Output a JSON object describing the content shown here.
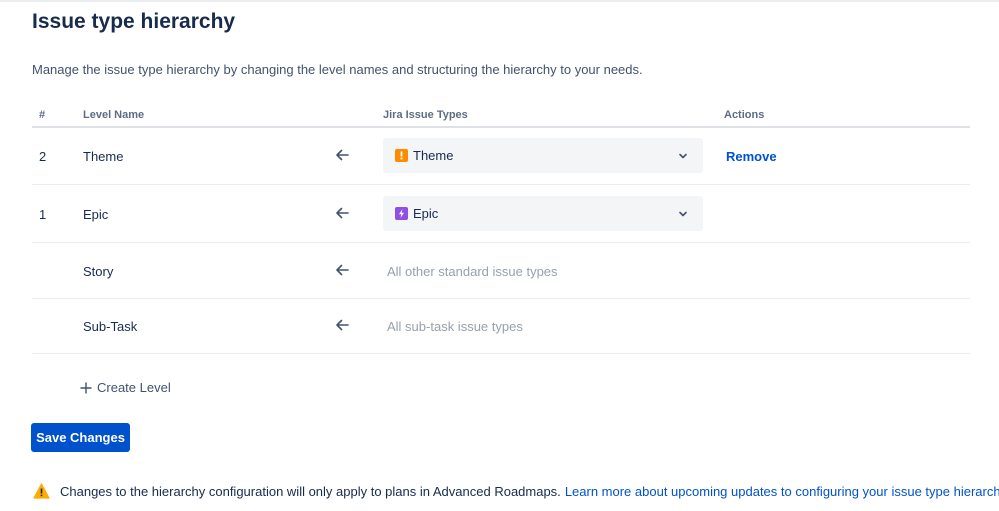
{
  "page": {
    "title": "Issue type hierarchy",
    "description": "Manage the issue type hierarchy by changing the level names and structuring the hierarchy to your needs."
  },
  "table": {
    "headers": {
      "number": "#",
      "level_name": "Level Name",
      "issue_types": "Jira Issue Types",
      "actions": "Actions"
    },
    "rows": [
      {
        "number": "2",
        "level_name": "Theme",
        "issue_type": "Theme",
        "issue_type_icon": "exclamation-icon",
        "issue_type_color": "#ff8b00",
        "action": "Remove"
      },
      {
        "number": "1",
        "level_name": "Epic",
        "issue_type": "Epic",
        "issue_type_icon": "lightning-icon",
        "issue_type_color": "#904ee2",
        "action": ""
      },
      {
        "number": "",
        "level_name": "Story",
        "issue_type_text": "All other standard issue types"
      },
      {
        "number": "",
        "level_name": "Sub-Task",
        "issue_type_text": "All sub-task issue types"
      }
    ]
  },
  "create_level_label": "Create Level",
  "save_button_label": "Save Changes",
  "warning": {
    "text": "Changes to the hierarchy configuration will only apply to plans in Advanced Roadmaps.",
    "link_text": "Learn more about upcoming updates to configuring your issue type hierarchy.",
    "icon_color": "#ffab00"
  },
  "colors": {
    "primary": "#0052cc",
    "text": "#172b4d",
    "muted": "#97a0af"
  }
}
